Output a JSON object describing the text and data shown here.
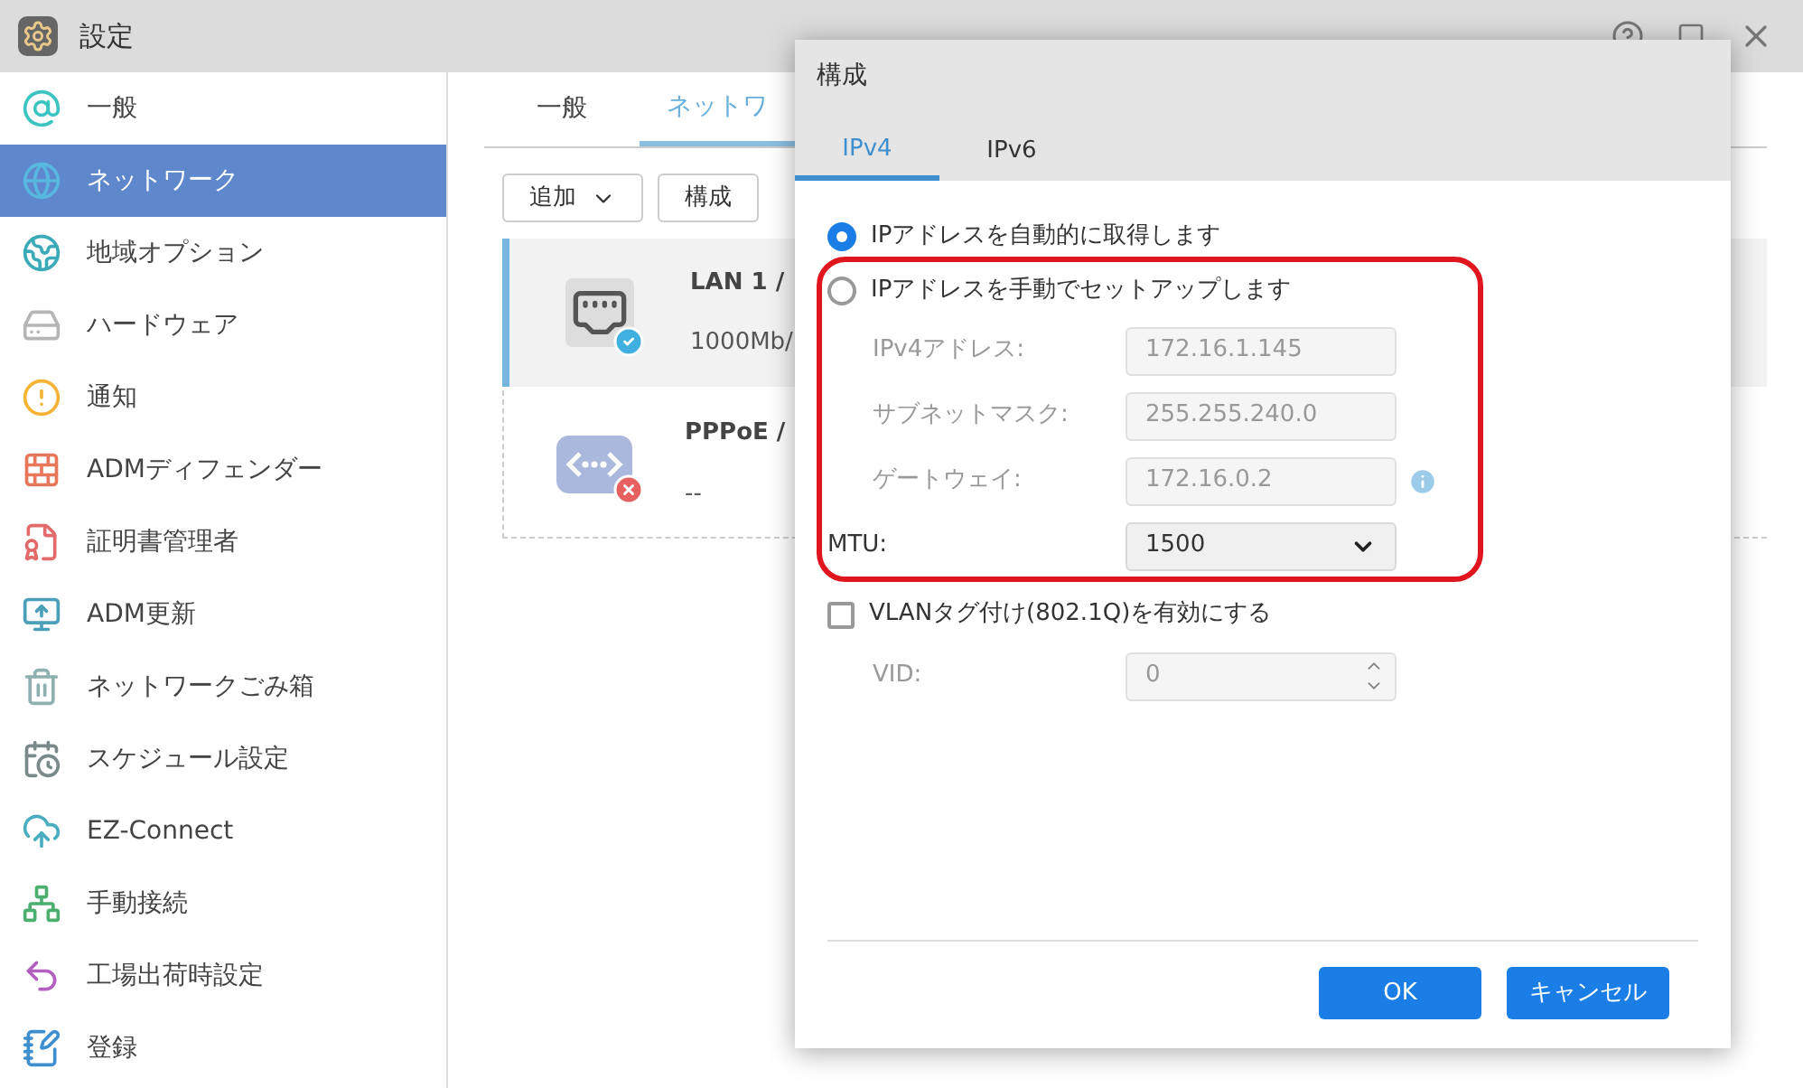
{
  "window": {
    "title": "設定"
  },
  "sidebar": {
    "items": [
      {
        "label": "一般",
        "selected": false
      },
      {
        "label": "ネットワーク",
        "selected": true
      },
      {
        "label": "地域オプション",
        "selected": false
      },
      {
        "label": "ハードウェア",
        "selected": false
      },
      {
        "label": "通知",
        "selected": false
      },
      {
        "label": "ADMディフェンダー",
        "selected": false
      },
      {
        "label": "証明書管理者",
        "selected": false
      },
      {
        "label": "ADM更新",
        "selected": false
      },
      {
        "label": "ネットワークごみ箱",
        "selected": false
      },
      {
        "label": "スケジュール設定",
        "selected": false
      },
      {
        "label": "EZ-Connect",
        "selected": false
      },
      {
        "label": "手動接続",
        "selected": false
      },
      {
        "label": "工場出荷時設定",
        "selected": false
      },
      {
        "label": "登録",
        "selected": false
      }
    ]
  },
  "content": {
    "tabs": [
      {
        "label": "一般",
        "selected": false
      },
      {
        "label": "ネットワ",
        "selected": true
      }
    ],
    "toolbar": [
      {
        "label": "追加",
        "dropdown": true
      },
      {
        "label": "構成",
        "dropdown": false
      }
    ],
    "interfaces": [
      {
        "name": "LAN 1 /",
        "detail": "1000Mb/",
        "selected": true,
        "connected": true
      },
      {
        "name": "PPPoE /",
        "detail": "--",
        "selected": false,
        "connected": false
      }
    ]
  },
  "dialog": {
    "title": "構成",
    "tabs": [
      {
        "label": "IPv4",
        "selected": true
      },
      {
        "label": "IPv6",
        "selected": false
      }
    ],
    "ip_mode": [
      {
        "label": "IPアドレスを自動的に取得します",
        "selected": true
      },
      {
        "label": "IPアドレスを手動でセットアップします",
        "selected": false
      }
    ],
    "fields": [
      {
        "label": "IPv4アドレス:",
        "value": "172.16.1.145",
        "disabled": true,
        "info": false
      },
      {
        "label": "サブネットマスク:",
        "value": "255.255.240.0",
        "disabled": true,
        "info": false
      },
      {
        "label": "ゲートウェイ:",
        "value": "172.16.0.2",
        "disabled": true,
        "info": true
      }
    ],
    "mtu": {
      "label": "MTU:",
      "value": "1500"
    },
    "vlan": {
      "label": "VLANタグ付け(802.1Q)を有効にする",
      "checked": false
    },
    "vid": {
      "label": "VID:",
      "value": "0",
      "disabled": true
    },
    "buttons": [
      "OK",
      "キャンセル"
    ]
  }
}
